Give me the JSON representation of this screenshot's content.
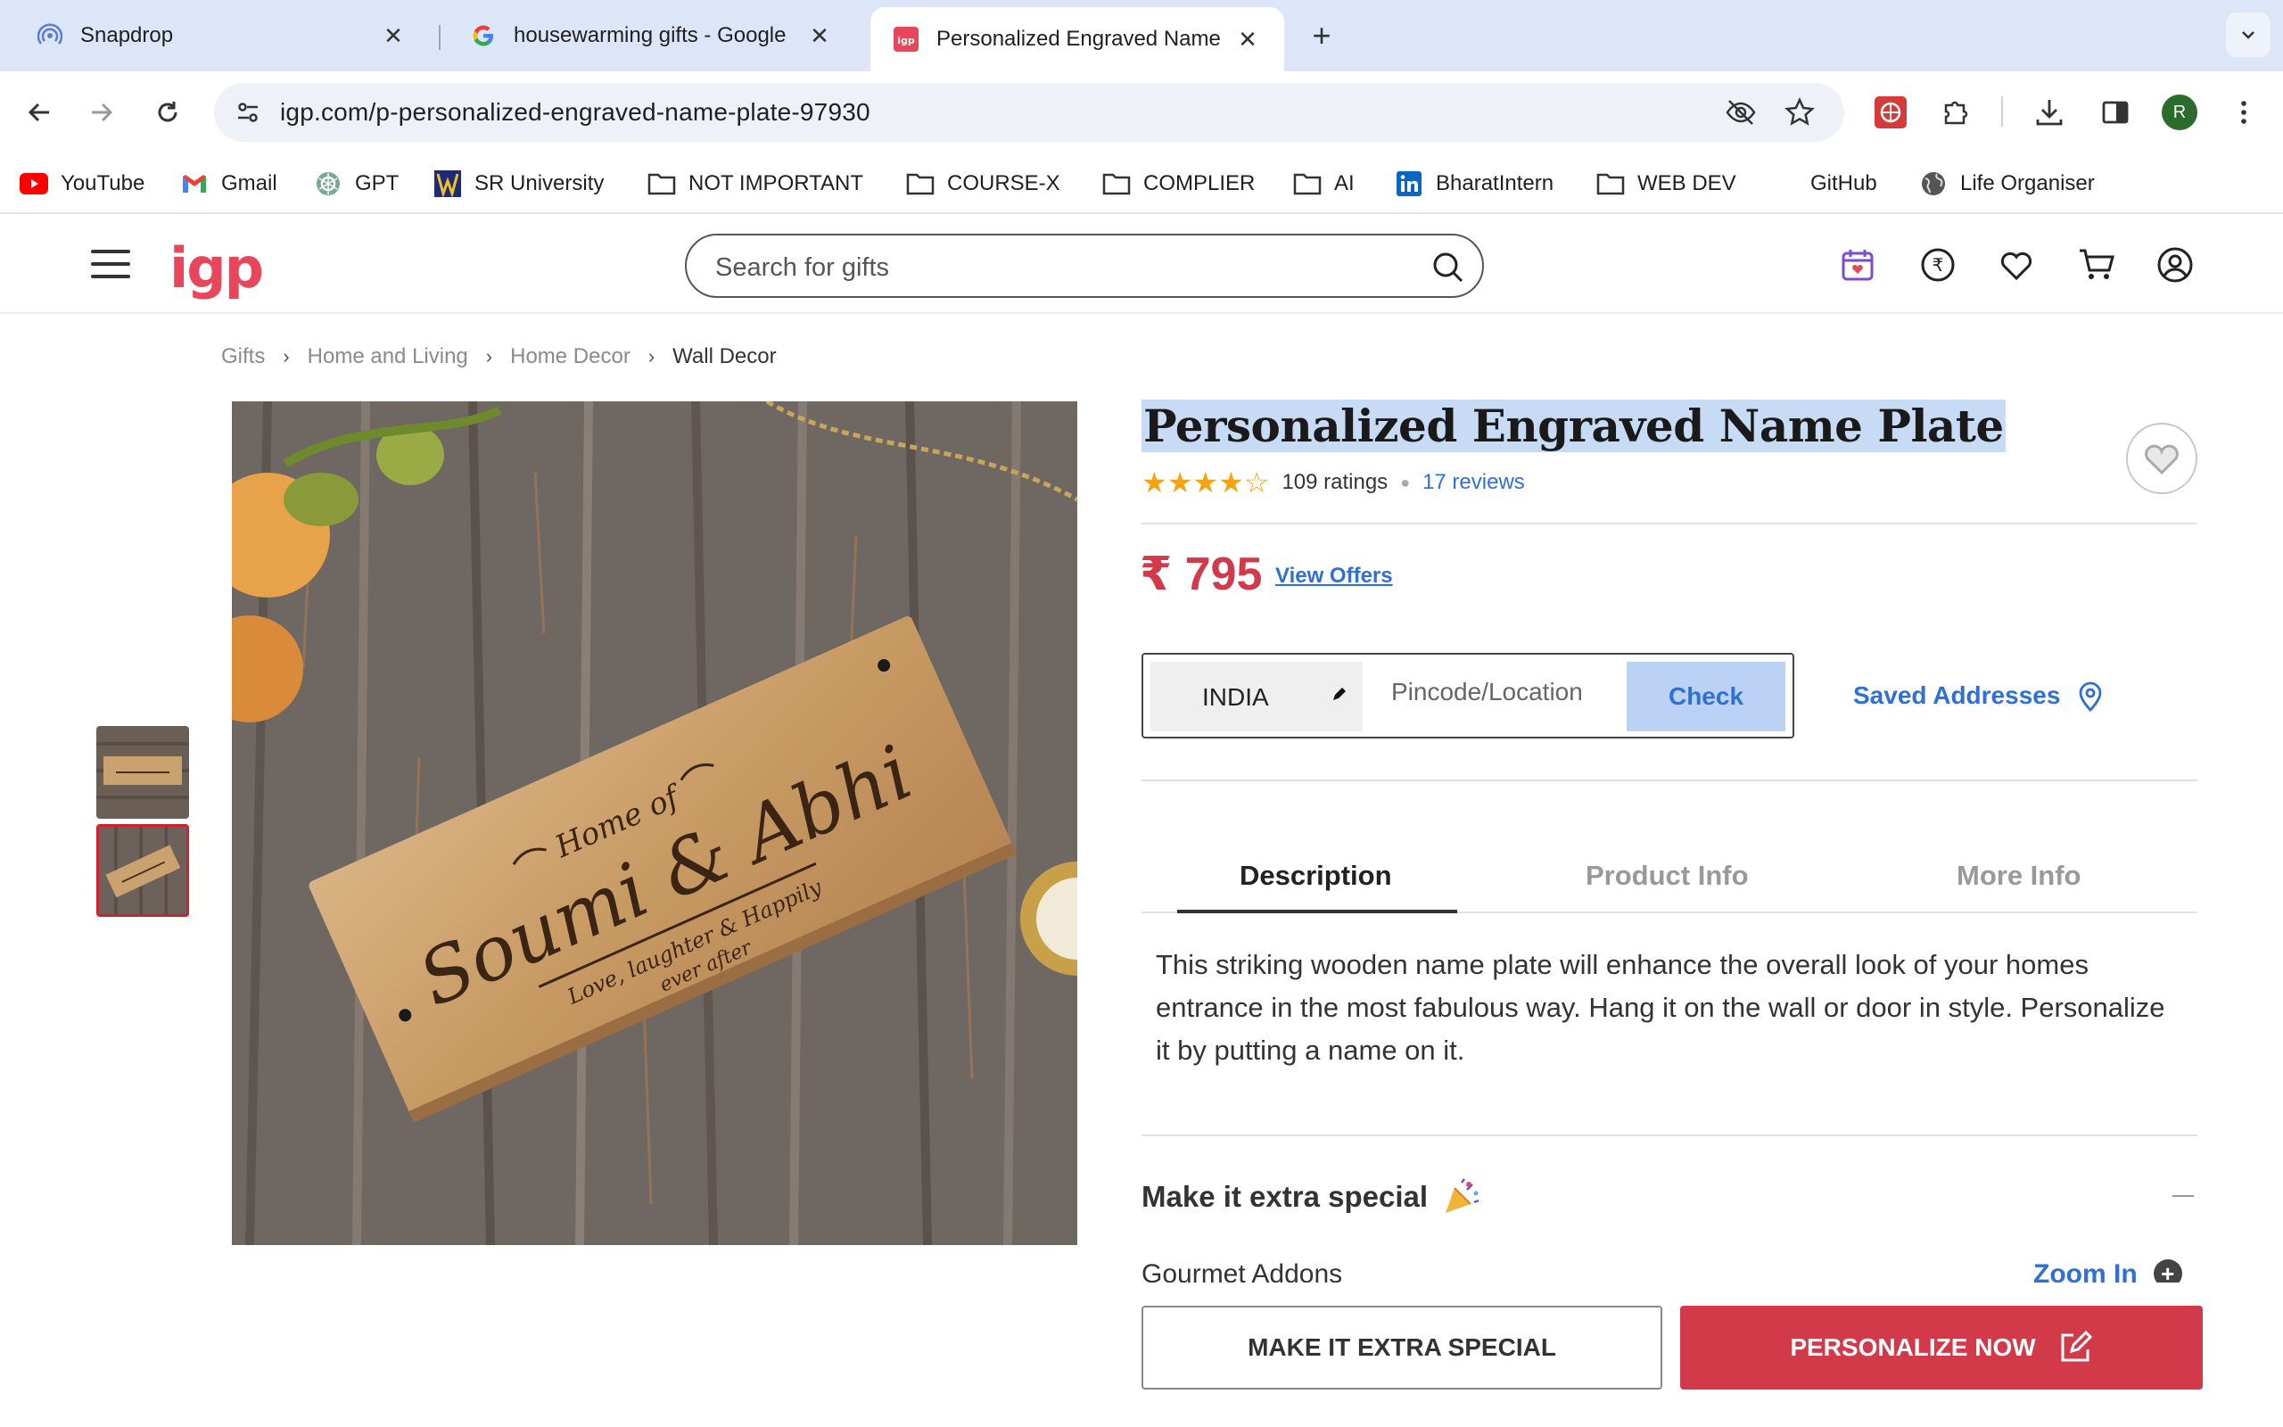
{
  "browser": {
    "tabs": [
      {
        "title": "Snapdrop",
        "favicon": "snapdrop-icon"
      },
      {
        "title": "housewarming gifts - Google",
        "favicon": "google-icon"
      },
      {
        "title": "Personalized Engraved Name",
        "favicon": "igp-icon"
      }
    ],
    "active_tab": 2,
    "url": "igp.com/p-personalized-engraved-name-plate-97930",
    "profile_initial": "R",
    "bookmarks": [
      {
        "label": "YouTube",
        "icon": "youtube-icon"
      },
      {
        "label": "Gmail",
        "icon": "gmail-icon"
      },
      {
        "label": "GPT",
        "icon": "gpt-icon"
      },
      {
        "label": "SR University",
        "icon": "sr-university-icon"
      },
      {
        "label": "NOT IMPORTANT",
        "icon": "folder-icon"
      },
      {
        "label": "COURSE-X",
        "icon": "folder-icon"
      },
      {
        "label": "COMPLIER",
        "icon": "folder-icon"
      },
      {
        "label": "AI",
        "icon": "folder-icon"
      },
      {
        "label": "BharatIntern",
        "icon": "linkedin-icon"
      },
      {
        "label": "WEB DEV",
        "icon": "folder-icon"
      },
      {
        "label": "GitHub",
        "icon": ""
      },
      {
        "label": "Life Organiser",
        "icon": "globe-icon"
      }
    ]
  },
  "site": {
    "logo": "igp",
    "search_placeholder": "Search for gifts",
    "accent_color": "#e8465a"
  },
  "breadcrumb": [
    "Gifts",
    "Home and Living",
    "Home Decor",
    "Wall Decor"
  ],
  "product": {
    "title": "Personalized Engraved Name Plate",
    "stars": "★★★★☆",
    "rating_value": 4.5,
    "ratings_count": "109 ratings",
    "reviews": "17 reviews",
    "price": "₹ 795",
    "offers_link": "View Offers",
    "plate_text": {
      "top": "Home of",
      "names": "Soumi & Abhi",
      "tagline_1": "Love, laughter & Happily",
      "tagline_2": "ever after"
    }
  },
  "delivery": {
    "country": "INDIA",
    "pincode_placeholder": "Pincode/Location",
    "check_label": "Check",
    "saved_addresses": "Saved Addresses"
  },
  "info_tabs": [
    "Description",
    "Product Info",
    "More Info"
  ],
  "description": "This striking wooden name plate will enhance the overall look of your homes entrance in the most fabulous way. Hang it on the wall or door in style. Personalize it by putting a name on it.",
  "extras": {
    "title": "Make it extra special",
    "addons_label": "Gourmet Addons",
    "zoom_label": "Zoom In"
  },
  "actions": {
    "extra_special": "MAKE IT EXTRA SPECIAL",
    "personalize": "PERSONALIZE NOW"
  }
}
